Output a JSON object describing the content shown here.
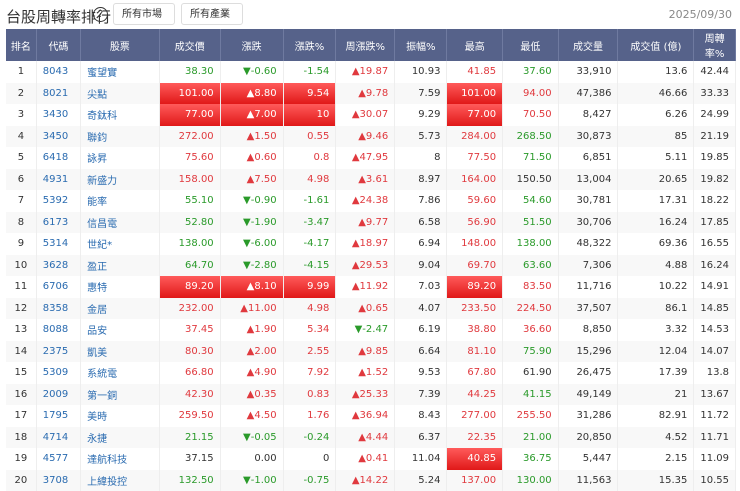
{
  "header": {
    "title": "台股周轉率排行",
    "help_icon": "?",
    "market_select": "所有市場",
    "industry_select": "所有產業",
    "date": "2025/09/30"
  },
  "columns": [
    "排名",
    "代碼",
    "股票",
    "成交價",
    "漲跌",
    "漲跌%",
    "周漲跌%",
    "振幅%",
    "最高",
    "最低",
    "成交量",
    "成交值 (億)",
    "周轉率%"
  ],
  "rows": [
    [
      "1",
      "8043",
      "蜜望實",
      "38.30",
      "▼-0.60",
      "-1.54",
      "▲19.87",
      "10.93",
      "41.85",
      "37.60",
      "33,910",
      "13.6",
      "42.44"
    ],
    [
      "2",
      "8021",
      "尖點",
      "101.00",
      "▲8.80",
      "9.54",
      "▲9.78",
      "7.59",
      "101.00",
      "94.00",
      "47,386",
      "46.66",
      "33.33"
    ],
    [
      "3",
      "3430",
      "奇鈦科",
      "77.00",
      "▲7.00",
      "10",
      "▲30.07",
      "9.29",
      "77.00",
      "70.50",
      "8,427",
      "6.26",
      "24.99"
    ],
    [
      "4",
      "3450",
      "聯鈞",
      "272.00",
      "▲1.50",
      "0.55",
      "▲9.46",
      "5.73",
      "284.00",
      "268.50",
      "30,873",
      "85",
      "21.19"
    ],
    [
      "5",
      "6418",
      "詠昇",
      "75.60",
      "▲0.60",
      "0.8",
      "▲47.95",
      "8",
      "77.50",
      "71.50",
      "6,851",
      "5.11",
      "19.85"
    ],
    [
      "6",
      "4931",
      "新盛力",
      "158.00",
      "▲7.50",
      "4.98",
      "▲3.61",
      "8.97",
      "164.00",
      "150.50",
      "13,004",
      "20.65",
      "19.82"
    ],
    [
      "7",
      "5392",
      "能率",
      "55.10",
      "▼-0.90",
      "-1.61",
      "▲24.38",
      "7.86",
      "59.60",
      "54.60",
      "30,781",
      "17.31",
      "18.22"
    ],
    [
      "8",
      "6173",
      "信昌電",
      "52.80",
      "▼-1.90",
      "-3.47",
      "▲9.77",
      "6.58",
      "56.90",
      "51.50",
      "30,706",
      "16.24",
      "17.85"
    ],
    [
      "9",
      "5314",
      "世紀*",
      "138.00",
      "▼-6.00",
      "-4.17",
      "▲18.97",
      "6.94",
      "148.00",
      "138.00",
      "48,322",
      "69.36",
      "16.55"
    ],
    [
      "10",
      "3628",
      "盈正",
      "64.70",
      "▼-2.80",
      "-4.15",
      "▲29.53",
      "9.04",
      "69.70",
      "63.60",
      "7,306",
      "4.88",
      "16.24"
    ],
    [
      "11",
      "6706",
      "惠特",
      "89.20",
      "▲8.10",
      "9.99",
      "▲11.92",
      "7.03",
      "89.20",
      "83.50",
      "11,716",
      "10.22",
      "14.91"
    ],
    [
      "12",
      "8358",
      "金居",
      "232.00",
      "▲11.00",
      "4.98",
      "▲0.65",
      "4.07",
      "233.50",
      "224.50",
      "37,507",
      "86.1",
      "14.85"
    ],
    [
      "13",
      "8088",
      "品安",
      "37.45",
      "▲1.90",
      "5.34",
      "▼-2.47",
      "6.19",
      "38.80",
      "36.60",
      "8,850",
      "3.32",
      "14.53"
    ],
    [
      "14",
      "2375",
      "凱美",
      "80.30",
      "▲2.00",
      "2.55",
      "▲9.85",
      "6.64",
      "81.10",
      "75.90",
      "15,296",
      "12.04",
      "14.07"
    ],
    [
      "15",
      "5309",
      "系統電",
      "66.80",
      "▲4.90",
      "7.92",
      "▲1.52",
      "9.53",
      "67.80",
      "61.90",
      "26,475",
      "17.39",
      "13.8"
    ],
    [
      "16",
      "2009",
      "第一銅",
      "42.30",
      "▲0.35",
      "0.83",
      "▲25.33",
      "7.39",
      "44.25",
      "41.15",
      "49,149",
      "21",
      "13.67"
    ],
    [
      "17",
      "1795",
      "美時",
      "259.50",
      "▲4.50",
      "1.76",
      "▲36.94",
      "8.43",
      "277.00",
      "255.50",
      "31,286",
      "82.91",
      "11.72"
    ],
    [
      "18",
      "4714",
      "永捷",
      "21.15",
      "▼-0.05",
      "-0.24",
      "▲4.44",
      "6.37",
      "22.35",
      "21.00",
      "20,850",
      "4.52",
      "11.71"
    ],
    [
      "19",
      "4577",
      "達航科技",
      "37.15",
      "0.00",
      "0",
      "▲0.41",
      "11.04",
      "40.85",
      "36.75",
      "5,447",
      "2.15",
      "11.09"
    ],
    [
      "20",
      "3708",
      "上緯投控",
      "132.50",
      "▼-1.00",
      "-0.75",
      "▲14.22",
      "5.24",
      "137.00",
      "130.00",
      "11,563",
      "15.35",
      "10.55"
    ]
  ],
  "row_styles": [
    [
      "down",
      "down",
      "down",
      "up",
      "up",
      "down"
    ],
    [
      "limit",
      "limit",
      "limit",
      "up",
      "limit",
      "up"
    ],
    [
      "limit",
      "limit",
      "limit",
      "up",
      "limit",
      "up"
    ],
    [
      "up",
      "up",
      "up",
      "up",
      "up",
      "down"
    ],
    [
      "up",
      "up",
      "up",
      "up",
      "up",
      "down"
    ],
    [
      "up",
      "up",
      "up",
      "up",
      "up",
      "flat"
    ],
    [
      "down",
      "down",
      "down",
      "up",
      "up",
      "down"
    ],
    [
      "down",
      "down",
      "down",
      "up",
      "up",
      "down"
    ],
    [
      "down",
      "down",
      "down",
      "up",
      "up",
      "down"
    ],
    [
      "down",
      "down",
      "down",
      "up",
      "up",
      "down"
    ],
    [
      "limit",
      "limit",
      "limit",
      "up",
      "limit",
      "up"
    ],
    [
      "up",
      "up",
      "up",
      "up",
      "up",
      "up"
    ],
    [
      "up",
      "up",
      "up",
      "down",
      "up",
      "up"
    ],
    [
      "up",
      "up",
      "up",
      "up",
      "up",
      "down"
    ],
    [
      "up",
      "up",
      "up",
      "up",
      "up",
      "flat"
    ],
    [
      "up",
      "up",
      "up",
      "up",
      "up",
      "down"
    ],
    [
      "up",
      "up",
      "up",
      "up",
      "up",
      "up"
    ],
    [
      "down",
      "down",
      "down",
      "up",
      "up",
      "down"
    ],
    [
      "flat",
      "flat",
      "flat",
      "up",
      "limit",
      "down"
    ],
    [
      "down",
      "down",
      "down",
      "up",
      "up",
      "down"
    ]
  ]
}
